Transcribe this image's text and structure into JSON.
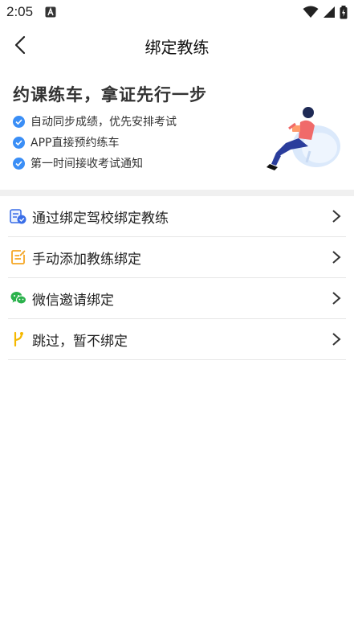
{
  "status_bar": {
    "time": "2:05"
  },
  "header": {
    "title": "绑定教练"
  },
  "banner": {
    "title": "约课练车，拿证先行一步",
    "features": [
      "自动同步成绩，优先安排考试",
      "APP直接预约练车",
      "第一时间接收考试通知"
    ]
  },
  "menu": {
    "items": [
      {
        "label": "通过绑定驾校绑定教练",
        "icon": "school-badge-icon"
      },
      {
        "label": "手动添加教练绑定",
        "icon": "edit-note-icon"
      },
      {
        "label": "微信邀请绑定",
        "icon": "wechat-icon"
      },
      {
        "label": "跳过，暂不绑定",
        "icon": "branch-icon"
      }
    ]
  },
  "colors": {
    "accent": "#3a8ef6",
    "orange": "#f5a623",
    "green": "#2bb24c",
    "yellow": "#f5b800"
  }
}
